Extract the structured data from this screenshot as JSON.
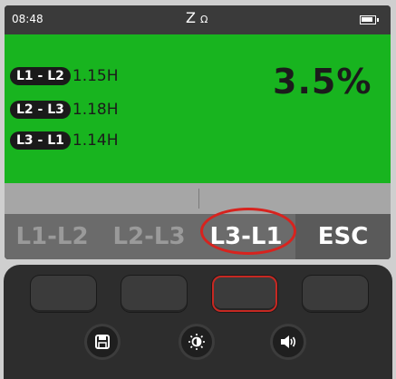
{
  "status": {
    "time": "08:48",
    "mode": "Z",
    "mode_sub": "Ω"
  },
  "readings": [
    {
      "pair": "L1 - L2",
      "value": "1.15H"
    },
    {
      "pair": "L2 - L3",
      "value": "1.18H"
    },
    {
      "pair": "L3 - L1",
      "value": "1.14H"
    }
  ],
  "percent": "3.5%",
  "softkeys": [
    "L1-L2",
    "L2-L3",
    "L3-L1",
    "ESC"
  ],
  "colors": {
    "screen_green": "#18b41f",
    "highlight": "#d7231e"
  },
  "icons": [
    "save-icon",
    "brightness-icon",
    "volume-icon"
  ]
}
